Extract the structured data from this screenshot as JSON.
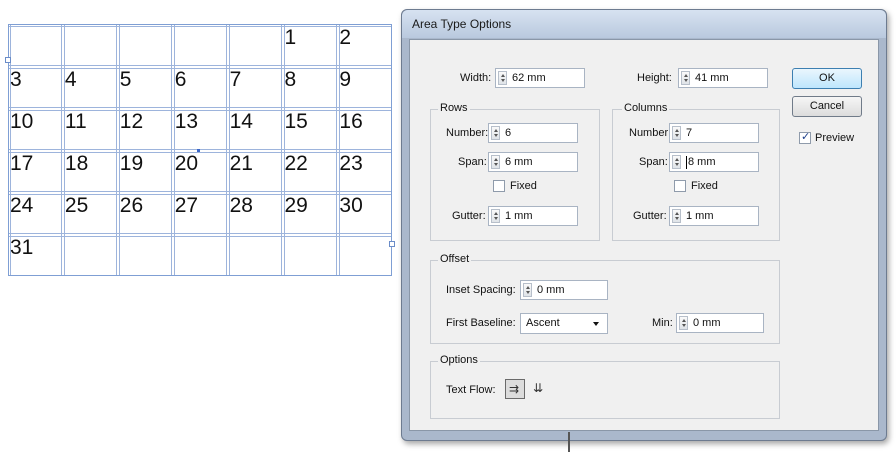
{
  "calendar": {
    "cells": [
      {
        "label": "1",
        "col": 5,
        "row": 0
      },
      {
        "label": "2",
        "col": 6,
        "row": 0
      },
      {
        "label": "3",
        "col": 0,
        "row": 1
      },
      {
        "label": "4",
        "col": 1,
        "row": 1
      },
      {
        "label": "5",
        "col": 2,
        "row": 1
      },
      {
        "label": "6",
        "col": 3,
        "row": 1
      },
      {
        "label": "7",
        "col": 4,
        "row": 1
      },
      {
        "label": "8",
        "col": 5,
        "row": 1
      },
      {
        "label": "9",
        "col": 6,
        "row": 1
      },
      {
        "label": "10",
        "col": 0,
        "row": 2
      },
      {
        "label": "11",
        "col": 1,
        "row": 2
      },
      {
        "label": "12",
        "col": 2,
        "row": 2
      },
      {
        "label": "13",
        "col": 3,
        "row": 2
      },
      {
        "label": "14",
        "col": 4,
        "row": 2
      },
      {
        "label": "15",
        "col": 5,
        "row": 2
      },
      {
        "label": "16",
        "col": 6,
        "row": 2
      },
      {
        "label": "17",
        "col": 0,
        "row": 3
      },
      {
        "label": "18",
        "col": 1,
        "row": 3
      },
      {
        "label": "19",
        "col": 2,
        "row": 3
      },
      {
        "label": "20",
        "col": 3,
        "row": 3
      },
      {
        "label": "21",
        "col": 4,
        "row": 3
      },
      {
        "label": "22",
        "col": 5,
        "row": 3
      },
      {
        "label": "23",
        "col": 6,
        "row": 3
      },
      {
        "label": "24",
        "col": 0,
        "row": 4
      },
      {
        "label": "25",
        "col": 1,
        "row": 4
      },
      {
        "label": "26",
        "col": 2,
        "row": 4
      },
      {
        "label": "27",
        "col": 3,
        "row": 4
      },
      {
        "label": "28",
        "col": 4,
        "row": 4
      },
      {
        "label": "29",
        "col": 5,
        "row": 4
      },
      {
        "label": "30",
        "col": 6,
        "row": 4
      },
      {
        "label": "31",
        "col": 0,
        "row": 5
      }
    ]
  },
  "dialog": {
    "title": "Area Type Options",
    "width": {
      "label": "Width:",
      "value": "62 mm"
    },
    "height": {
      "label": "Height:",
      "value": "41 mm"
    },
    "rows": {
      "title": "Rows",
      "number": {
        "label": "Number:",
        "value": "6"
      },
      "span": {
        "label": "Span:",
        "value": "6 mm"
      },
      "fixed": {
        "label": "Fixed",
        "checked": false
      },
      "gutter": {
        "label": "Gutter:",
        "value": "1 mm"
      }
    },
    "columns": {
      "title": "Columns",
      "number": {
        "label": "Number:",
        "value": "7"
      },
      "span": {
        "label": "Span:",
        "value": "8 mm"
      },
      "fixed": {
        "label": "Fixed",
        "checked": false
      },
      "gutter": {
        "label": "Gutter:",
        "value": "1 mm"
      }
    },
    "offset": {
      "title": "Offset",
      "inset": {
        "label": "Inset Spacing:",
        "value": "0 mm"
      },
      "first_baseline": {
        "label": "First Baseline:",
        "value": "Ascent"
      },
      "min": {
        "label": "Min:",
        "value": "0 mm"
      }
    },
    "options": {
      "title": "Options",
      "text_flow_label": "Text Flow:",
      "text_flow_selected": "rows-first"
    },
    "buttons": {
      "ok": "OK",
      "cancel": "Cancel"
    },
    "preview": {
      "label": "Preview",
      "checked": true
    }
  },
  "icons": [
    "spinner-icon",
    "dropdown-arrow-icon",
    "text-flow-rows-icon",
    "text-flow-columns-icon",
    "checkmark-icon"
  ],
  "colors": {
    "grid_line": "#9db4dc",
    "selection": "#6a8cc8",
    "default_button": "#bee6fd"
  }
}
